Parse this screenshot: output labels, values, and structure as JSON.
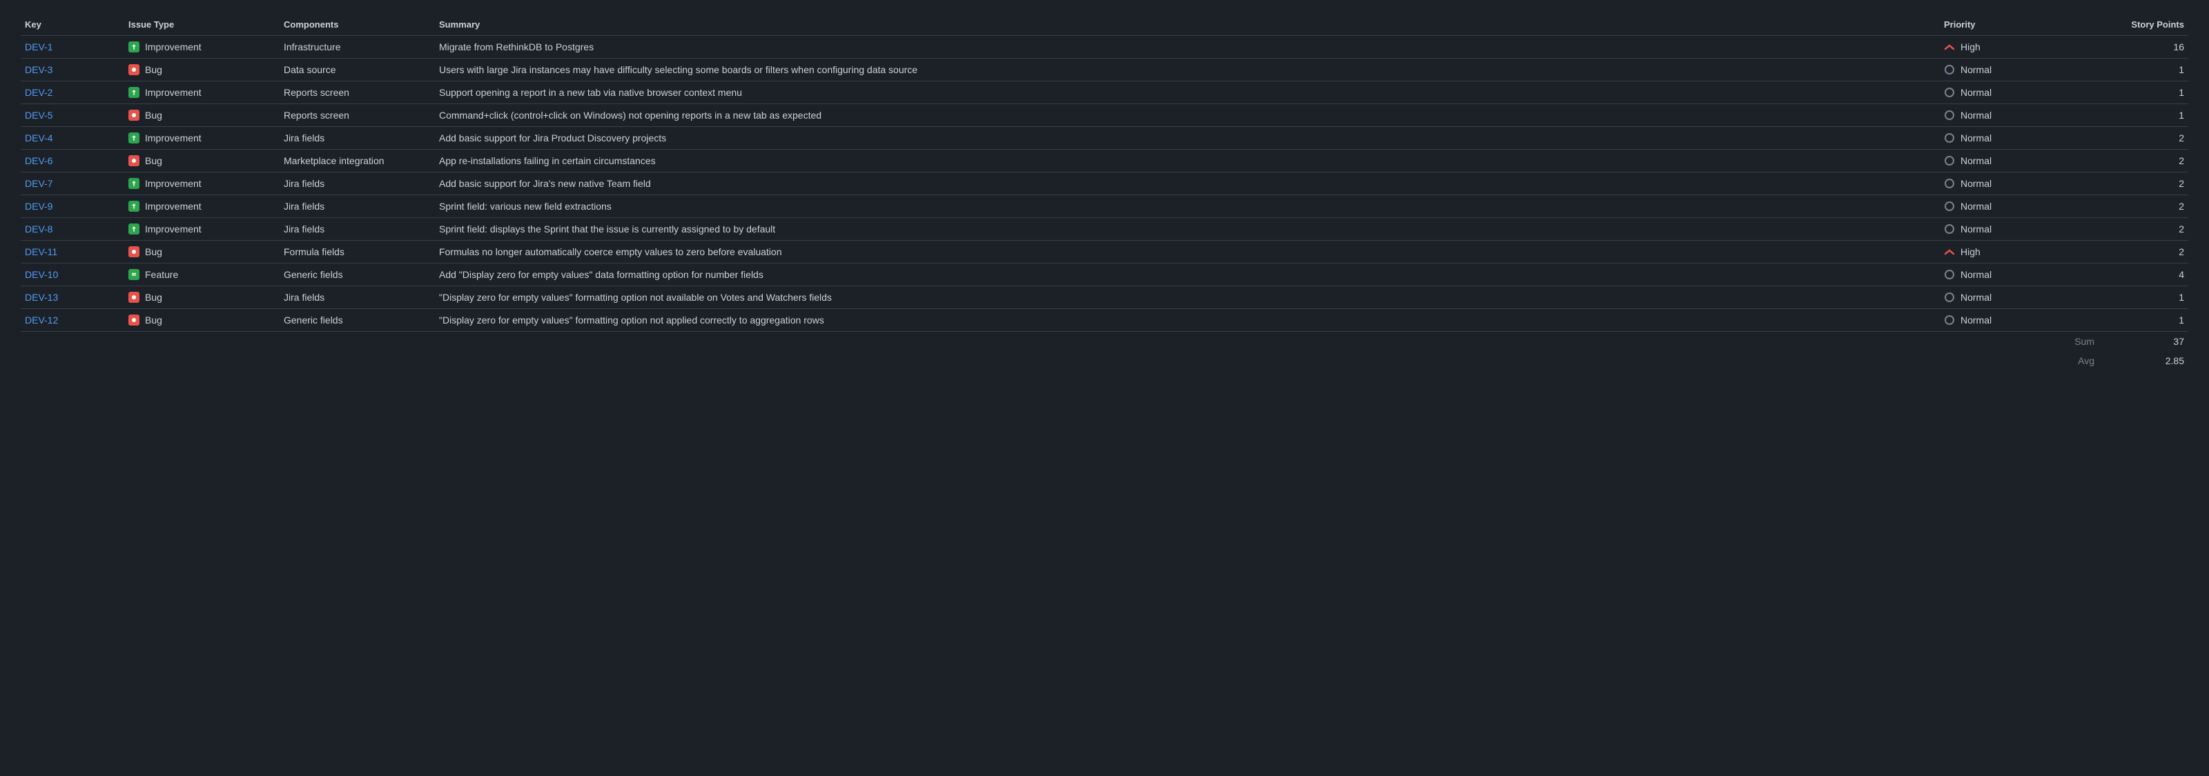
{
  "columns": {
    "key": "Key",
    "issue_type": "Issue Type",
    "components": "Components",
    "summary": "Summary",
    "priority": "Priority",
    "story_points": "Story Points"
  },
  "issue_types": {
    "improvement": "Improvement",
    "bug": "Bug",
    "feature": "Feature"
  },
  "priorities": {
    "high": "High",
    "normal": "Normal"
  },
  "rows": [
    {
      "key": "DEV-1",
      "type": "improvement",
      "components": "Infrastructure",
      "summary": "Migrate from RethinkDB to Postgres",
      "priority": "high",
      "points": "16"
    },
    {
      "key": "DEV-3",
      "type": "bug",
      "components": "Data source",
      "summary": "Users with large Jira instances may have difficulty selecting some boards or filters when configuring data source",
      "priority": "normal",
      "points": "1"
    },
    {
      "key": "DEV-2",
      "type": "improvement",
      "components": "Reports screen",
      "summary": "Support opening a report in a new tab via native browser context menu",
      "priority": "normal",
      "points": "1"
    },
    {
      "key": "DEV-5",
      "type": "bug",
      "components": "Reports screen",
      "summary": "Command+click (control+click on Windows) not opening reports in a new tab as expected",
      "priority": "normal",
      "points": "1"
    },
    {
      "key": "DEV-4",
      "type": "improvement",
      "components": "Jira fields",
      "summary": "Add basic support for Jira Product Discovery projects",
      "priority": "normal",
      "points": "2"
    },
    {
      "key": "DEV-6",
      "type": "bug",
      "components": "Marketplace integration",
      "summary": "App re-installations failing in certain circumstances",
      "priority": "normal",
      "points": "2"
    },
    {
      "key": "DEV-7",
      "type": "improvement",
      "components": "Jira fields",
      "summary": "Add basic support for Jira's new native Team field",
      "priority": "normal",
      "points": "2"
    },
    {
      "key": "DEV-9",
      "type": "improvement",
      "components": "Jira fields",
      "summary": "Sprint field: various new field extractions",
      "priority": "normal",
      "points": "2"
    },
    {
      "key": "DEV-8",
      "type": "improvement",
      "components": "Jira fields",
      "summary": "Sprint field: displays the Sprint that the issue is currently assigned to by default",
      "priority": "normal",
      "points": "2"
    },
    {
      "key": "DEV-11",
      "type": "bug",
      "components": "Formula fields",
      "summary": "Formulas no longer automatically coerce empty values to zero before evaluation",
      "priority": "high",
      "points": "2"
    },
    {
      "key": "DEV-10",
      "type": "feature",
      "components": "Generic fields",
      "summary": "Add \"Display zero for empty values\" data formatting option for number fields",
      "priority": "normal",
      "points": "4"
    },
    {
      "key": "DEV-13",
      "type": "bug",
      "components": "Jira fields",
      "summary": "\"Display zero for empty values\" formatting option not available on Votes and Watchers fields",
      "priority": "normal",
      "points": "1"
    },
    {
      "key": "DEV-12",
      "type": "bug",
      "components": "Generic fields",
      "summary": "\"Display zero for empty values\" formatting option not applied correctly to aggregation rows",
      "priority": "normal",
      "points": "1"
    }
  ],
  "footer": {
    "sum_label": "Sum",
    "sum_value": "37",
    "avg_label": "Avg",
    "avg_value": "2.85"
  }
}
